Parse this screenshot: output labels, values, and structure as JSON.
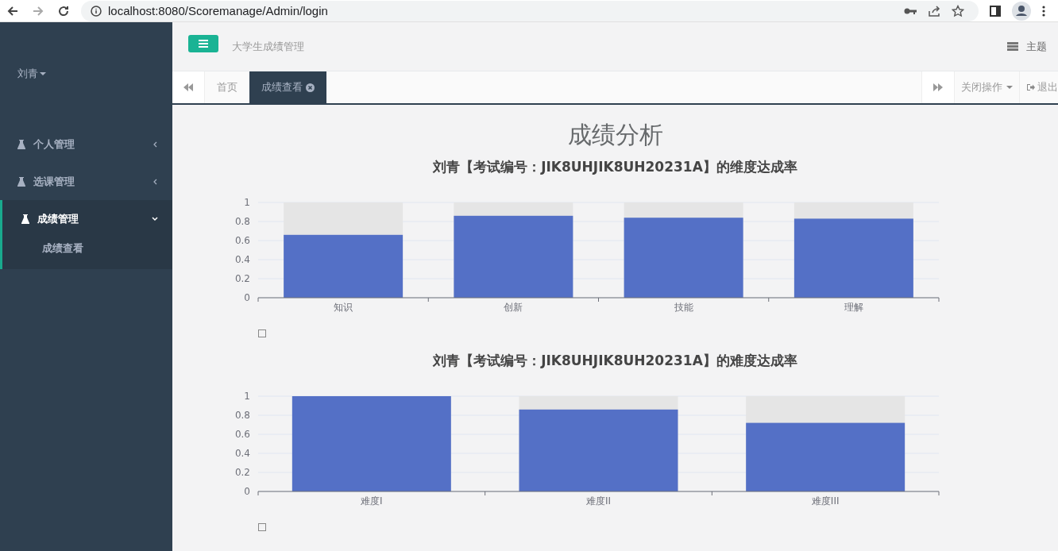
{
  "browser": {
    "url": "localhost:8080/Scoremanage/Admin/login"
  },
  "sidebar": {
    "user": "刘青",
    "items": [
      {
        "label": "个人管理",
        "expanded": false
      },
      {
        "label": "选课管理",
        "expanded": false
      },
      {
        "label": "成绩管理",
        "expanded": true,
        "children": [
          {
            "label": "成绩查看"
          }
        ]
      }
    ]
  },
  "header": {
    "title": "大学生成绩管理",
    "theme": "主题"
  },
  "tabs": [
    {
      "label": "首页",
      "selected": false,
      "closable": false
    },
    {
      "label": "成绩查看",
      "selected": true,
      "closable": true
    }
  ],
  "tab_actions": {
    "close_ops": "关闭操作",
    "logout": "退出"
  },
  "page_title": "成绩分析",
  "charts": [
    {
      "chart_data": {
        "type": "bar",
        "title": "刘青【考试编号：JIK8UHJIK8UH20231A】的维度达成率",
        "categories": [
          "知识",
          "创新",
          "技能",
          "理解"
        ],
        "series": [
          {
            "color": "#5470c6",
            "values": [
              0.66,
              0.86,
              0.84,
              0.83
            ]
          }
        ],
        "ylim": [
          0,
          1
        ],
        "yticks": [
          0,
          0.2,
          0.4,
          0.6,
          0.8,
          1
        ],
        "grid": true
      }
    },
    {
      "chart_data": {
        "type": "bar",
        "title": "刘青【考试编号：JIK8UHJIK8UH20231A】的难度达成率",
        "categories": [
          "难度I",
          "难度II",
          "难度III"
        ],
        "series": [
          {
            "color": "#5470c6",
            "values": [
              1,
              0.86,
              0.72
            ]
          }
        ],
        "ylim": [
          0,
          1
        ],
        "yticks": [
          0,
          0.2,
          0.4,
          0.6,
          0.8,
          1
        ],
        "grid": true
      }
    }
  ]
}
